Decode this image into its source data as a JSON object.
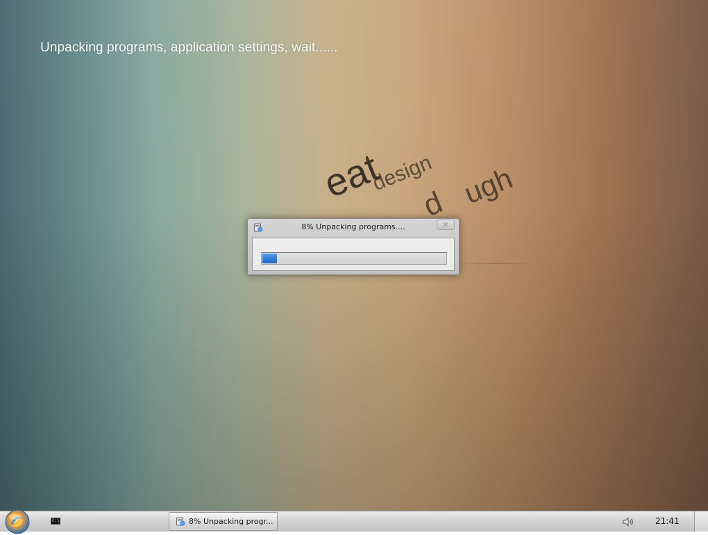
{
  "desktop": {
    "status_text": "Unpacking programs, application settings, wait......",
    "wallpaper_words": [
      "eat",
      "design",
      "d",
      "ugh"
    ]
  },
  "dialog": {
    "title": "8% Unpacking programs....",
    "close_glyph": "✕",
    "progress_fraction": 0.08,
    "progress_color": "#2f80e0",
    "app_icon": "installer-icon"
  },
  "taskbar": {
    "start_icon": "start-orb-icon",
    "quicklaunch_icon": "console-icon",
    "quicklaunch_glyph": "C:\\",
    "task_label": "8% Unpacking progr...",
    "task_icon": "installer-icon",
    "volume_icon": "speaker-icon",
    "clock": "21:41"
  }
}
